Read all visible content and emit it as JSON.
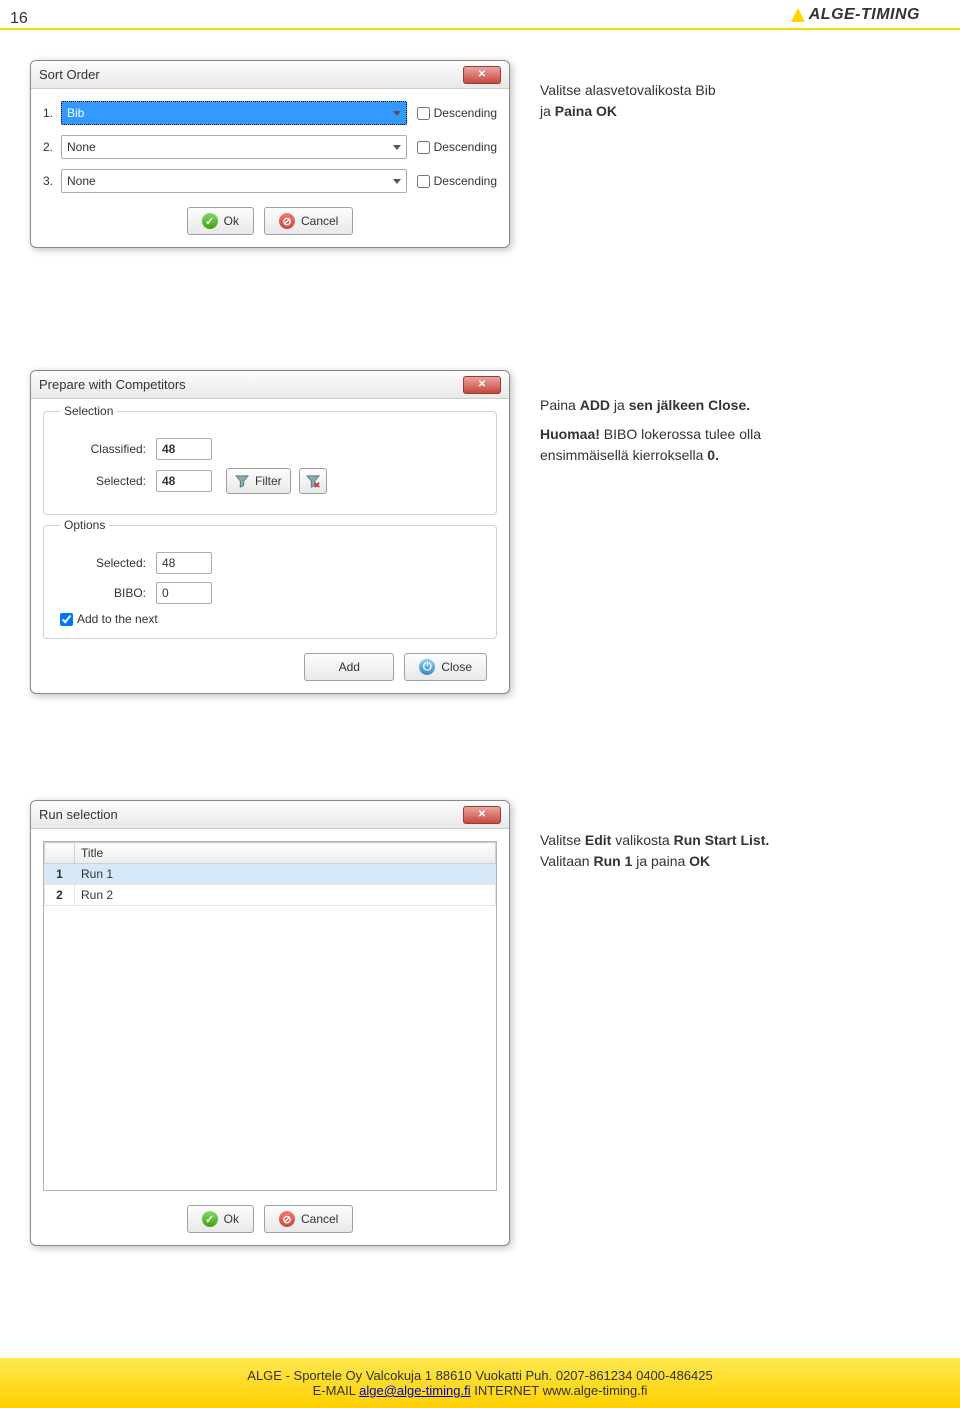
{
  "page_number": "16",
  "logo": {
    "brand": "ALGE-TIMING"
  },
  "instr1": {
    "line1": "Valitse alasvetovalikosta Bib",
    "line2a": "ja ",
    "line2b": "Paina OK"
  },
  "sort_dialog": {
    "title": "Sort Order",
    "rows": [
      {
        "num": "1.",
        "value": "Bib",
        "selected": true,
        "desc_label": "Descending"
      },
      {
        "num": "2.",
        "value": "None",
        "selected": false,
        "desc_label": "Descending"
      },
      {
        "num": "3.",
        "value": "None",
        "selected": false,
        "desc_label": "Descending"
      }
    ],
    "ok": "Ok",
    "cancel": "Cancel"
  },
  "instr2": {
    "line1a": "Paina ",
    "line1b": "ADD",
    "line1c": " ja ",
    "line1d": "sen jälkeen Close.",
    "line2a": "Huomaa!",
    "line2b": " BIBO lokerossa tulee olla",
    "line3a": "ensimmäisellä kierroksella ",
    "line3b": "0."
  },
  "prep_dialog": {
    "title": "Prepare with Competitors",
    "selection_label": "Selection",
    "classified_label": "Classified:",
    "classified_value": "48",
    "selected_label": "Selected:",
    "selected_value": "48",
    "filter_label": "Filter",
    "options_label": "Options",
    "opt_selected_label": "Selected:",
    "opt_selected_value": "48",
    "bibo_label": "BIBO:",
    "bibo_value": "0",
    "add_next_label": "Add to the next",
    "add": "Add",
    "close": "Close"
  },
  "instr3": {
    "line1a": "Valitse ",
    "line1b": "Edit",
    "line1c": " valikosta ",
    "line1d": "Run Start List.",
    "line2a": "Valitaan ",
    "line2b": "Run 1",
    "line2c": " ja paina ",
    "line2d": "OK"
  },
  "run_dialog": {
    "title": "Run selection",
    "col_num": " ",
    "col_title": "Title",
    "rows": [
      {
        "n": "1",
        "title": "Run 1",
        "sel": true
      },
      {
        "n": "2",
        "title": "Run 2",
        "sel": false
      }
    ],
    "ok": "Ok",
    "cancel": "Cancel"
  },
  "footer": {
    "line1a": "ALGE - Sportele Oy Valcokuja 1 88610 Vuokatti  Puh. 0207-861234  0400-486425",
    "line2a": "E-MAIL ",
    "line2b": "alge@alge-timing.fi",
    "line2c": "   INTERNET   www.alge-timing.fi"
  }
}
